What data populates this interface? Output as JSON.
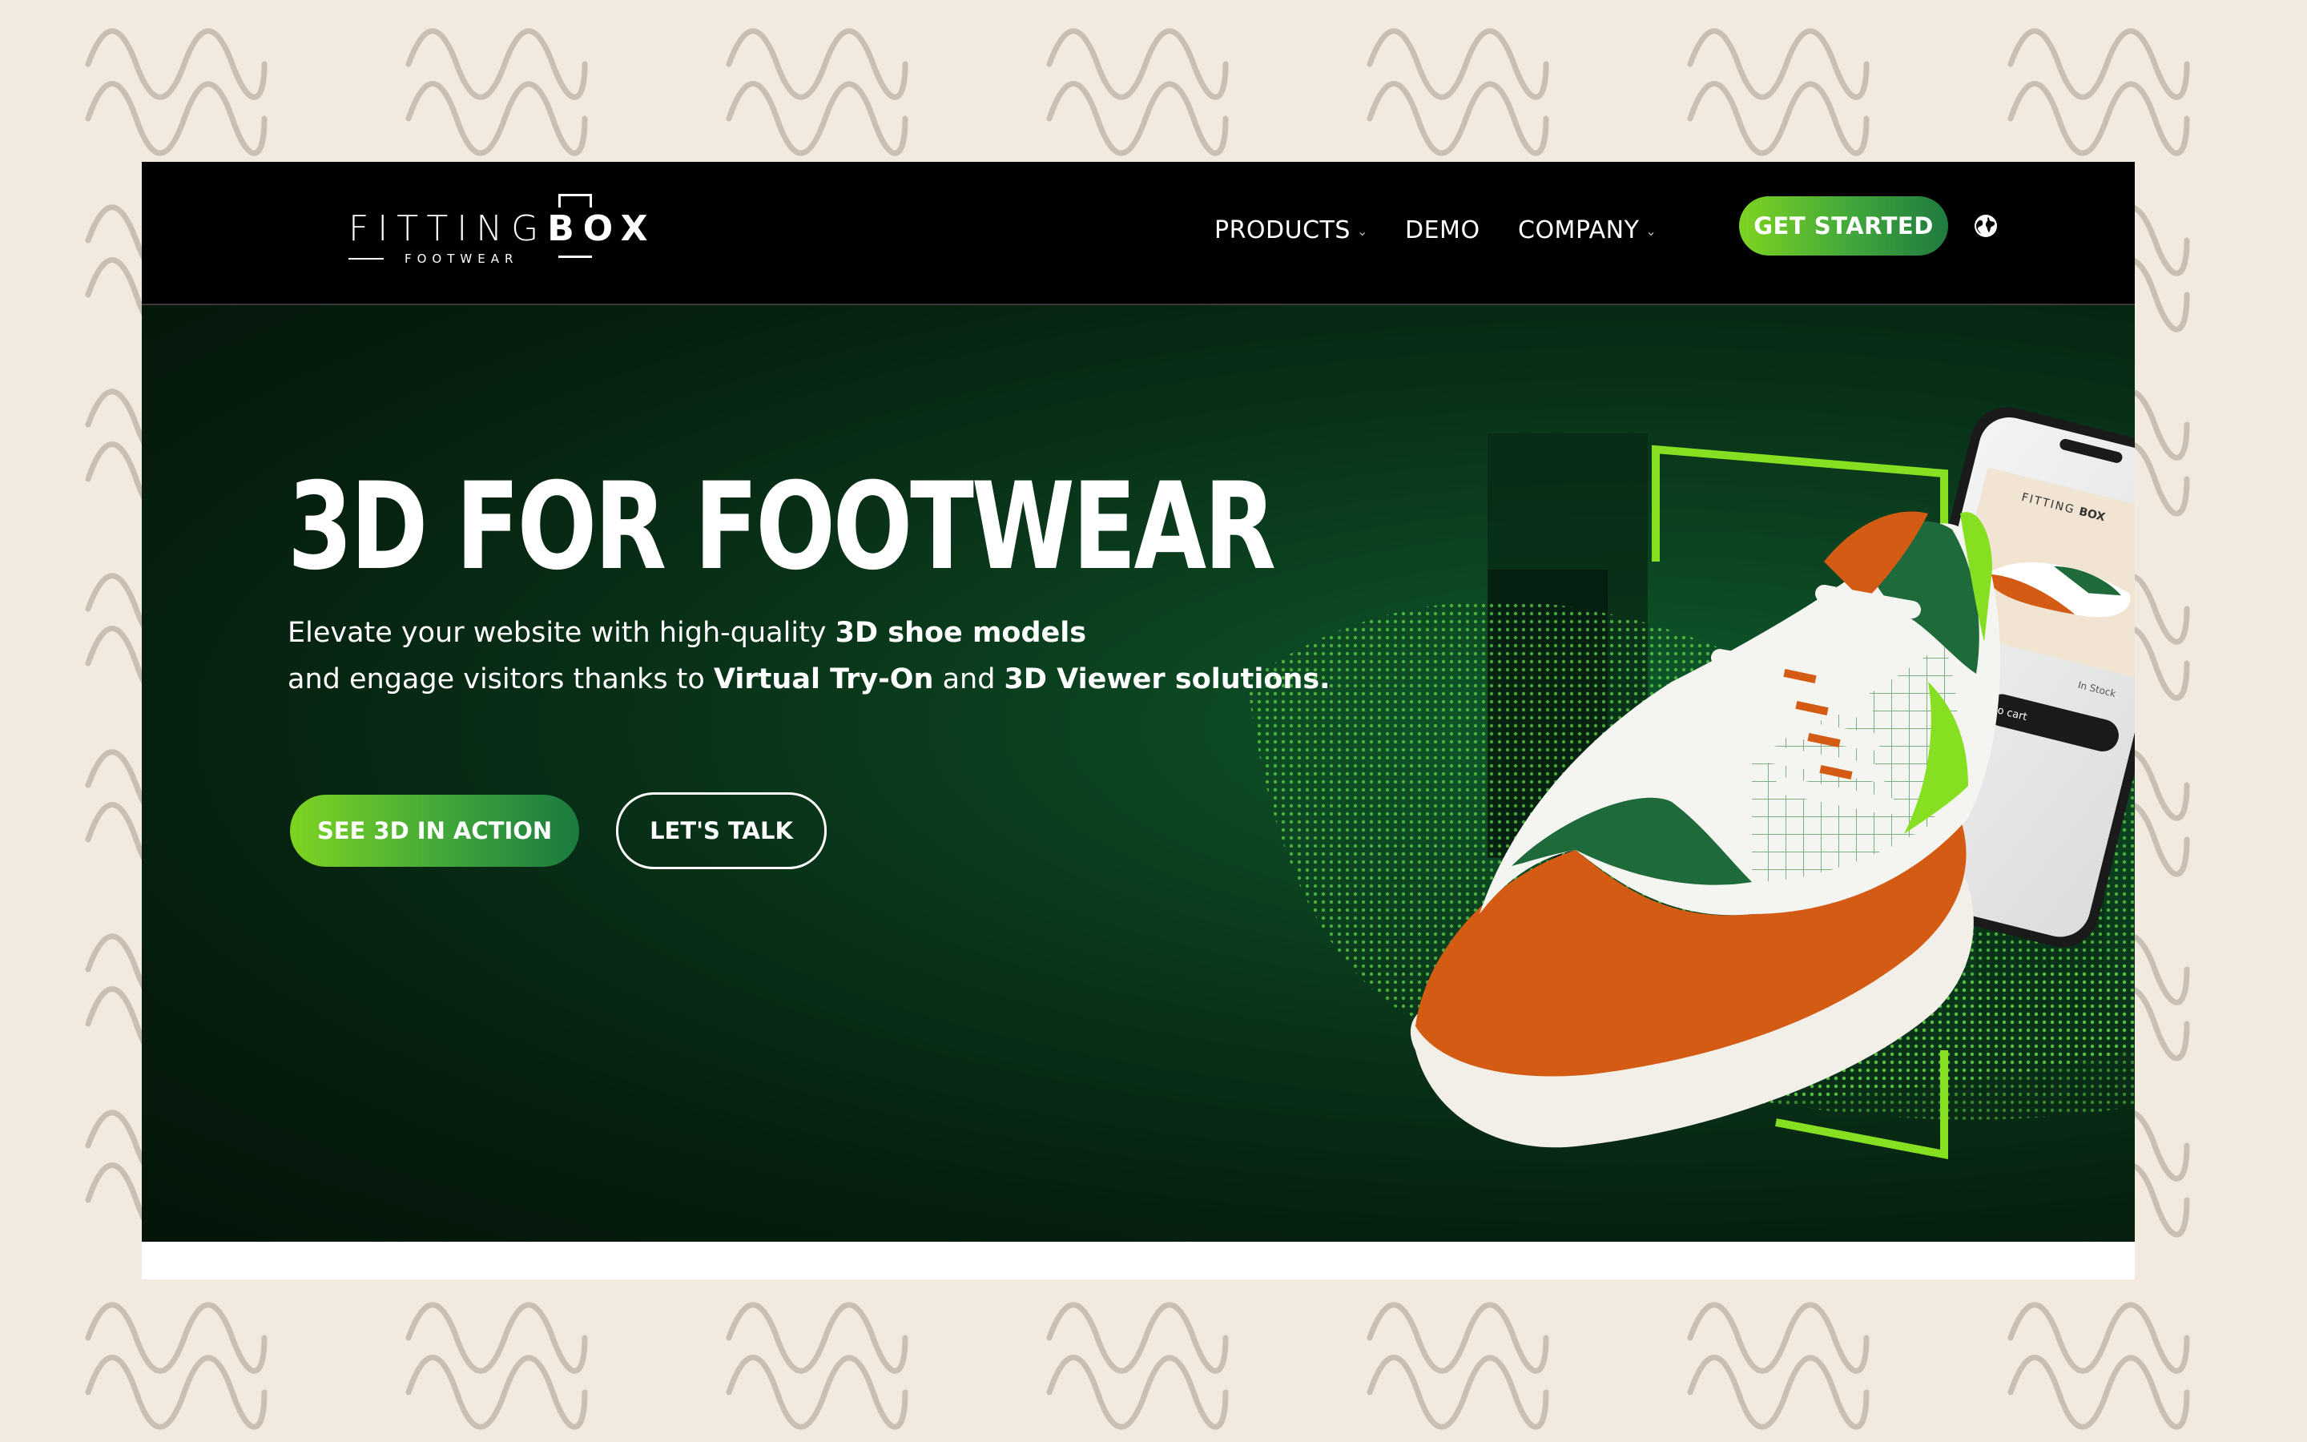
{
  "brand": {
    "name_light": "FITTING",
    "name_bold": "BOX",
    "tagline": "FOOTWEAR"
  },
  "nav": {
    "items": [
      {
        "label": "PRODUCTS",
        "has_dropdown": true
      },
      {
        "label": "DEMO",
        "has_dropdown": false
      },
      {
        "label": "COMPANY",
        "has_dropdown": true
      }
    ],
    "cta_label": "GET STARTED",
    "language_icon": "globe-icon"
  },
  "hero": {
    "title": "3D FOR FOOTWEAR",
    "line1_regular": "Elevate your website with high-quality ",
    "line1_bold": "3D shoe models",
    "line2_regular_a": "and engage visitors thanks to ",
    "line2_bold_a": "Virtual Try-On",
    "line2_regular_b": " and ",
    "line2_bold_b": "3D Viewer solutions.",
    "primary_button": "SEE 3D IN ACTION",
    "secondary_button": "LET'S TALK"
  },
  "phone_screen": {
    "brand_light": "FITTING",
    "brand_bold": "BOX",
    "stock": "In Stock",
    "cart": "to cart"
  },
  "chat_icon": "chat-bubble-icon",
  "colors": {
    "page_bg": "#f2e9df",
    "nav_bg": "#000000",
    "accent_green": "#7ed321",
    "deep_green": "#1f7a3f",
    "hero_dark": "#06200f",
    "shoe_orange": "#d35b14"
  }
}
